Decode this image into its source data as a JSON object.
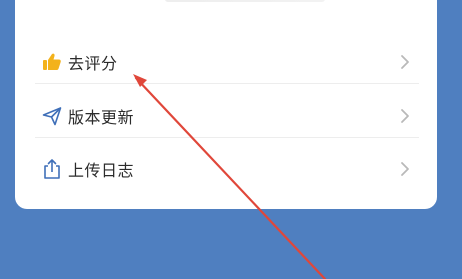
{
  "menu": {
    "items": [
      {
        "label": "去评分",
        "icon": "thumbs-up-icon"
      },
      {
        "label": "版本更新",
        "icon": "paper-plane-icon"
      },
      {
        "label": "上传日志",
        "icon": "upload-icon"
      }
    ]
  },
  "colors": {
    "background": "#4f7fc0",
    "card": "#ffffff",
    "annotation_arrow": "#e0473a",
    "thumb_icon": "#f3b21b",
    "nav_icon": "#3f6fb8"
  }
}
